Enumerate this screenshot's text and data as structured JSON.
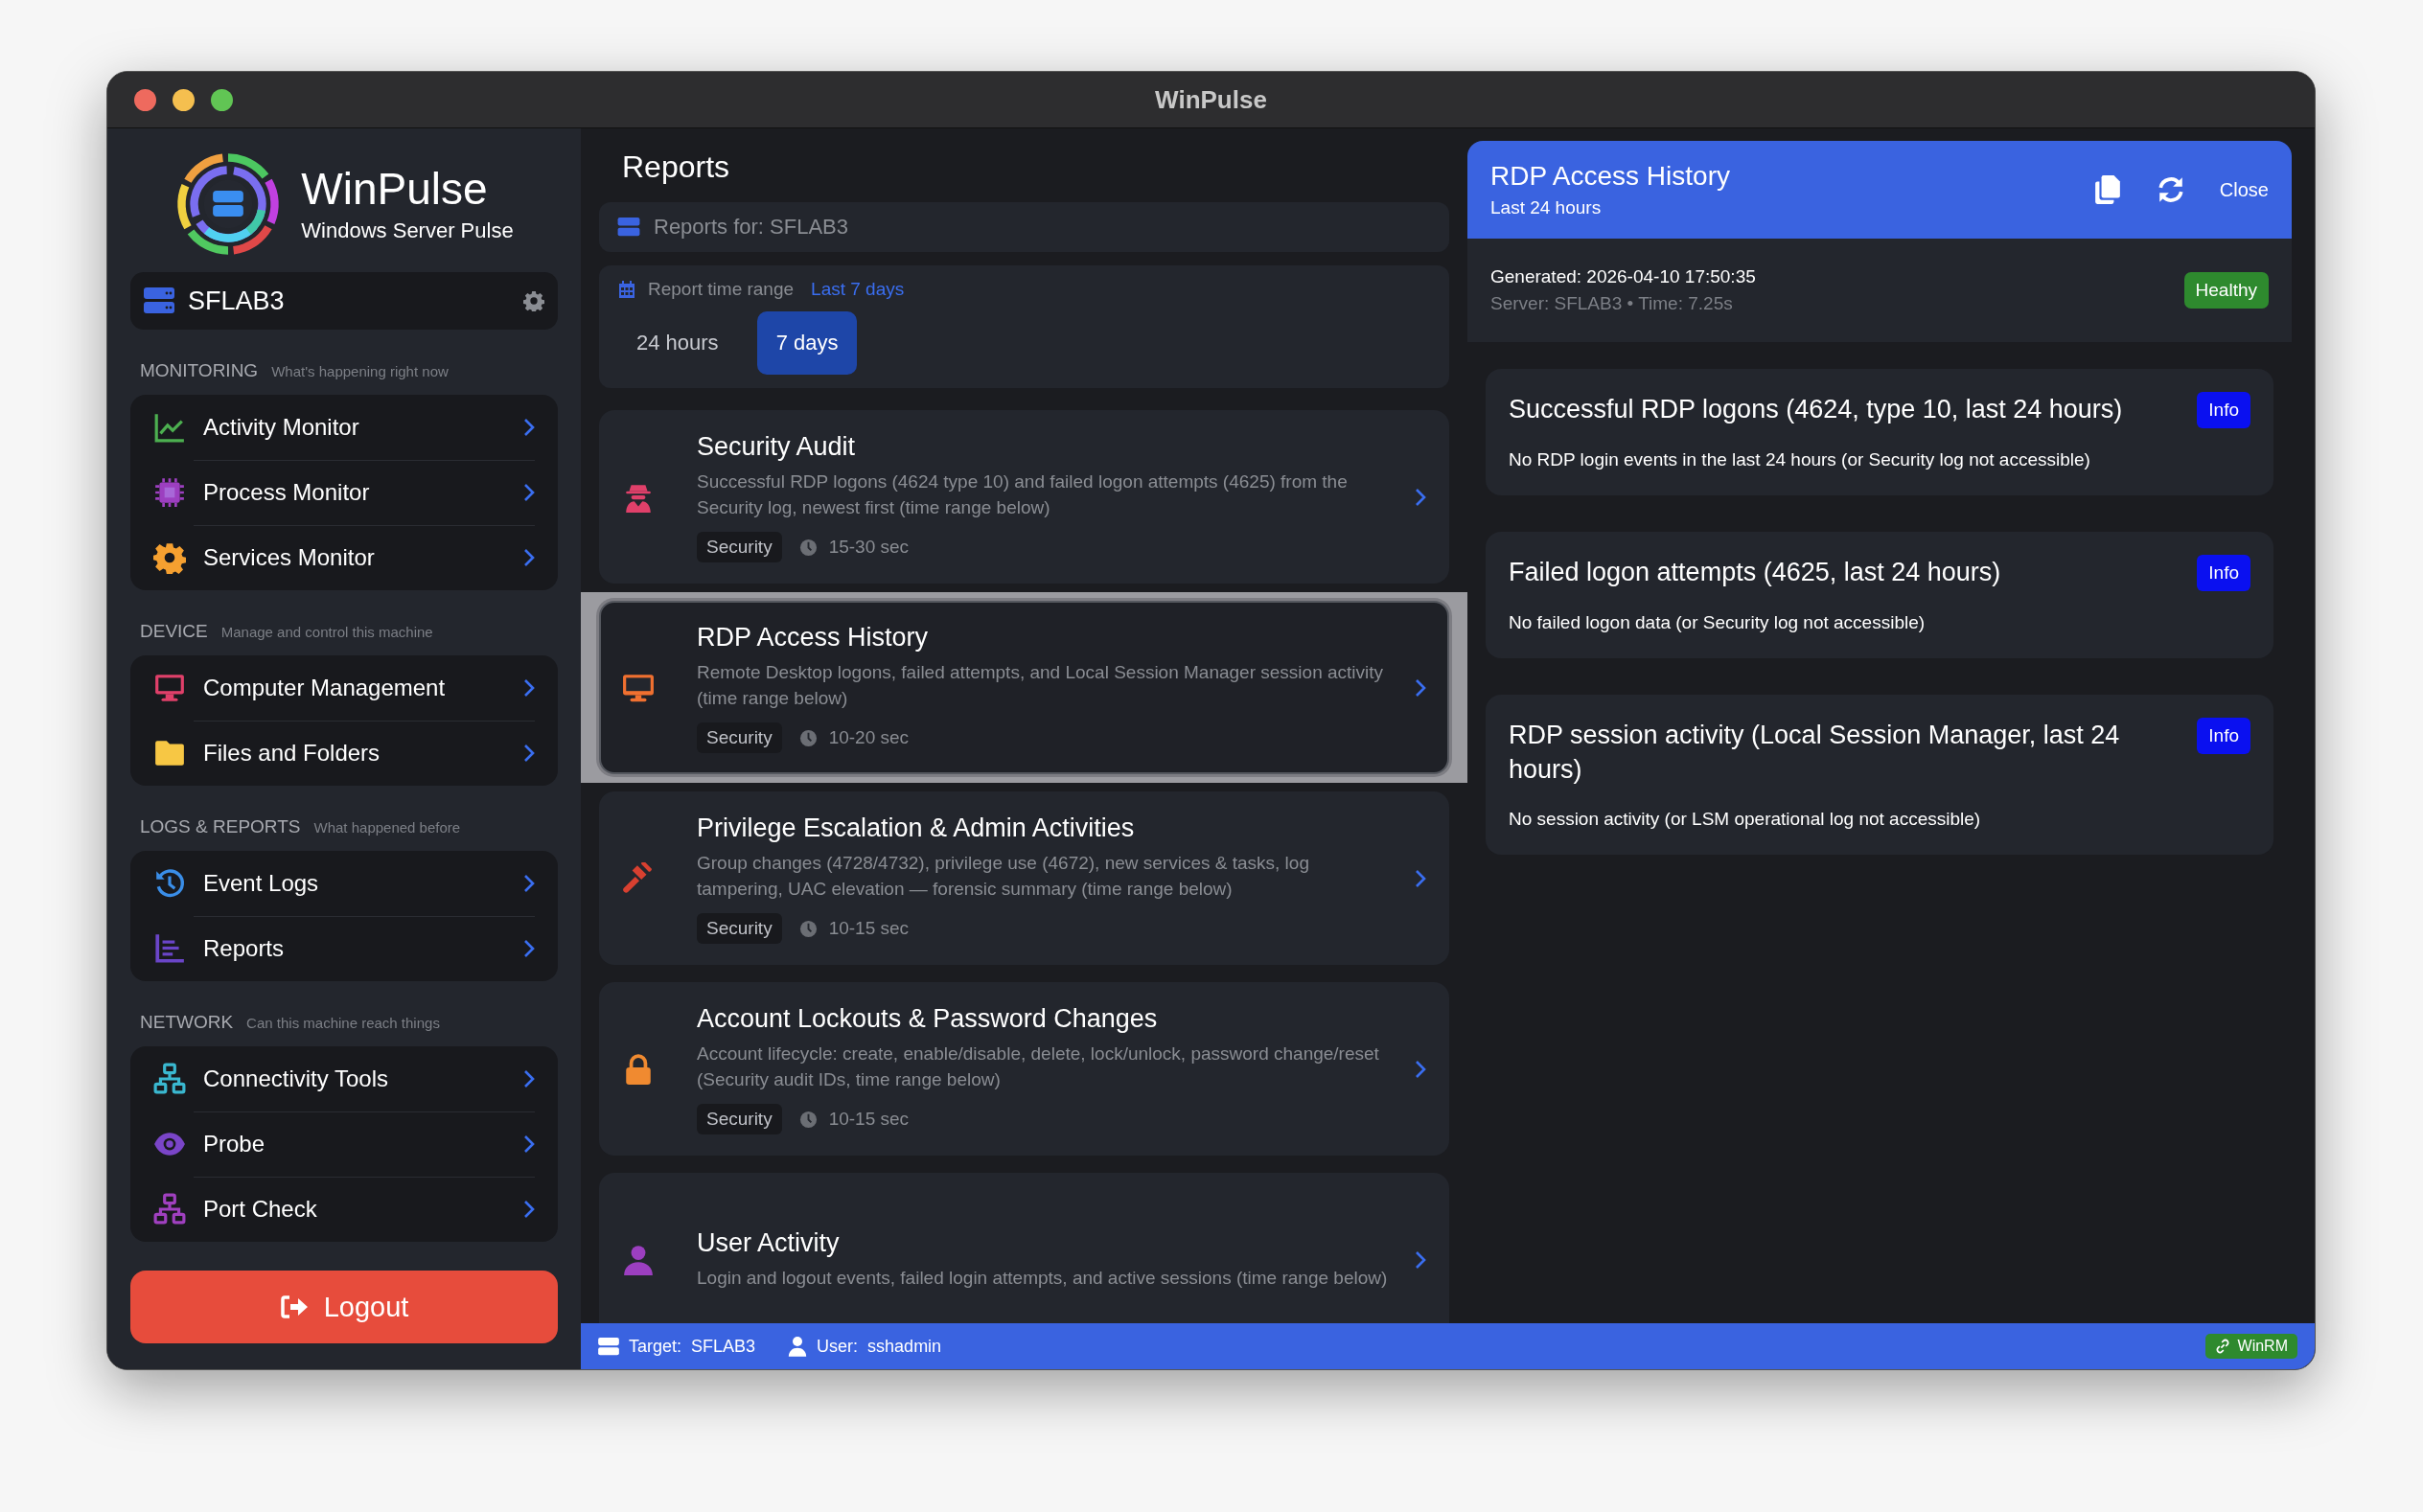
{
  "window": {
    "title": "WinPulse"
  },
  "sidebar": {
    "app_name": "WinPulse",
    "app_subtitle": "Windows Server Pulse",
    "server": "SFLAB3",
    "sections": [
      {
        "title": "MONITORING",
        "subtitle": "What's happening right now",
        "items": [
          {
            "label": "Activity Monitor"
          },
          {
            "label": "Process Monitor"
          },
          {
            "label": "Services Monitor"
          }
        ]
      },
      {
        "title": "DEVICE",
        "subtitle": "Manage and control this machine",
        "items": [
          {
            "label": "Computer Management"
          },
          {
            "label": "Files and Folders"
          }
        ]
      },
      {
        "title": "LOGS & REPORTS",
        "subtitle": "What happened before",
        "items": [
          {
            "label": "Event Logs"
          },
          {
            "label": "Reports"
          }
        ]
      },
      {
        "title": "NETWORK",
        "subtitle": "Can this machine reach things",
        "items": [
          {
            "label": "Connectivity Tools"
          },
          {
            "label": "Probe"
          },
          {
            "label": "Port Check"
          }
        ]
      }
    ],
    "logout": "Logout"
  },
  "reports": {
    "title": "Reports",
    "target_label": "Reports for: SFLAB3",
    "time_range": {
      "label": "Report time range",
      "value": "Last 7 days",
      "options": [
        {
          "label": "24 hours",
          "selected": false
        },
        {
          "label": "7 days",
          "selected": true
        }
      ]
    },
    "items": [
      {
        "title": "Security Audit",
        "description": "Successful RDP logons (4624 type 10) and failed logon attempts (4625) from the Security log, newest first (time range below)",
        "tag": "Security",
        "duration": "15-30 sec",
        "selected": false
      },
      {
        "title": "RDP Access History",
        "description": "Remote Desktop logons, failed attempts, and Local Session Manager session activity (time range below)",
        "tag": "Security",
        "duration": "10-20 sec",
        "selected": true
      },
      {
        "title": "Privilege Escalation & Admin Activities",
        "description": "Group changes (4728/4732), privilege use (4672), new services & tasks, log tampering, UAC elevation — forensic summary (time range below)",
        "tag": "Security",
        "duration": "10-15 sec",
        "selected": false
      },
      {
        "title": "Account Lockouts & Password Changes",
        "description": "Account lifecycle: create, enable/disable, delete, lock/unlock, password change/reset (Security audit IDs, time range below)",
        "tag": "Security",
        "duration": "10-15 sec",
        "selected": false
      },
      {
        "title": "User Activity",
        "description": "Login and logout events, failed login attempts, and active sessions (time range below)",
        "selected": false
      }
    ]
  },
  "detail": {
    "title": "RDP Access History",
    "subtitle": "Last 24 hours",
    "close": "Close",
    "generated": "Generated: 2026-04-10 17:50:35",
    "meta": "Server: SFLAB3 • Time: 7.25s",
    "status": "Healthy",
    "findings": [
      {
        "title": "Successful RDP logons (4624, type 10, last 24 hours)",
        "text": "No RDP login events in the last 24 hours (or Security log not accessible)",
        "badge": "Info"
      },
      {
        "title": "Failed logon attempts (4625, last 24 hours)",
        "text": "No failed logon data (or Security log not accessible)",
        "badge": "Info"
      },
      {
        "title": "RDP session activity (Local Session Manager, last 24 hours)",
        "text": "No session activity (or LSM operational log not accessible)",
        "badge": "Info"
      }
    ]
  },
  "status_bar": {
    "target_label": "Target:",
    "target": "SFLAB3",
    "user_label": "User:",
    "user": "sshadmin",
    "connection": "WinRM"
  }
}
